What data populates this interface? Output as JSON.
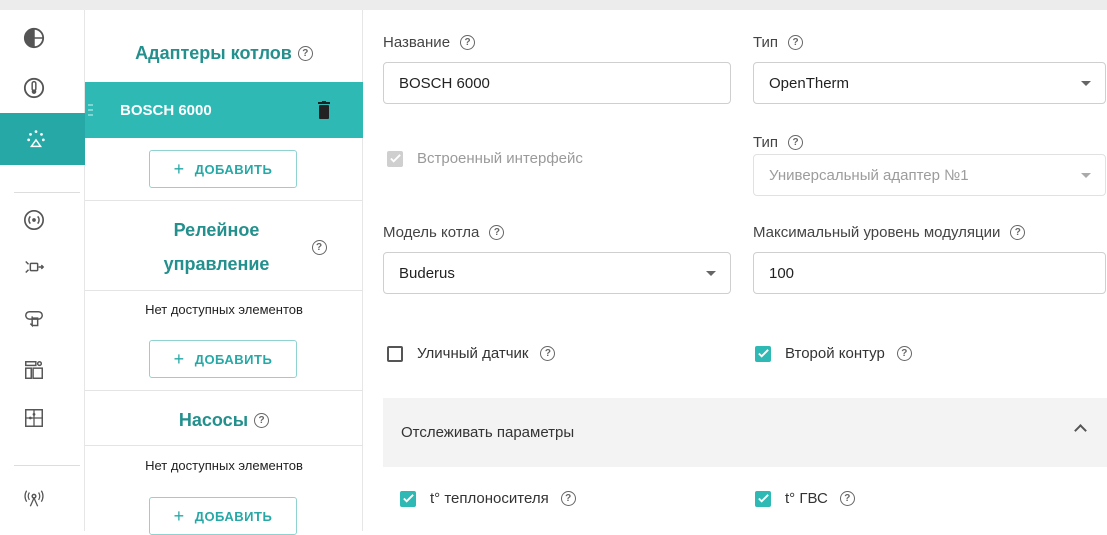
{
  "sidebar": {
    "icons": [
      "thermostat-globe-icon",
      "thermometer-icon",
      "heating-network-icon",
      "signal-icon",
      "sensor-relay-icon",
      "touch-hand-icon",
      "dashboard-icon",
      "scenario-puzzle-icon",
      "radio-icon"
    ],
    "active_index": 2
  },
  "adapters": {
    "title": "Адаптеры котлов",
    "items": [
      {
        "label": "BOSCH 6000"
      }
    ],
    "add_label": "ДОБАВИТЬ"
  },
  "relay": {
    "title": "Релейное управление",
    "empty_text": "Нет доступных элементов",
    "add_label": "ДОБАВИТЬ"
  },
  "pumps": {
    "title": "Насосы",
    "empty_text": "Нет доступных элементов",
    "add_label": "ДОБАВИТЬ"
  },
  "form": {
    "name_label": "Название",
    "name_value": "BOSCH 6000",
    "type_label": "Тип",
    "type_value": "OpenTherm",
    "builtin_label": "Встроенный интерфейс",
    "builtin_checked": true,
    "type2_label": "Тип",
    "type2_value": "Универсальный адаптер №1",
    "model_label": "Модель котла",
    "model_value": "Buderus",
    "max_mod_label": "Максимальный уровень модуляции",
    "max_mod_value": "100",
    "outdoor_label": "Уличный датчик",
    "outdoor_checked": false,
    "second_circuit_label": "Второй контур",
    "second_circuit_checked": true,
    "track_label": "Отслеживать параметры",
    "track_expanded": true,
    "coolant_label": "t° теплоносителя",
    "coolant_checked": true,
    "dhw_label": "t° ГВС",
    "dhw_checked": true
  },
  "colors": {
    "accent": "#2fb9b5",
    "accent_text": "#23908d"
  }
}
